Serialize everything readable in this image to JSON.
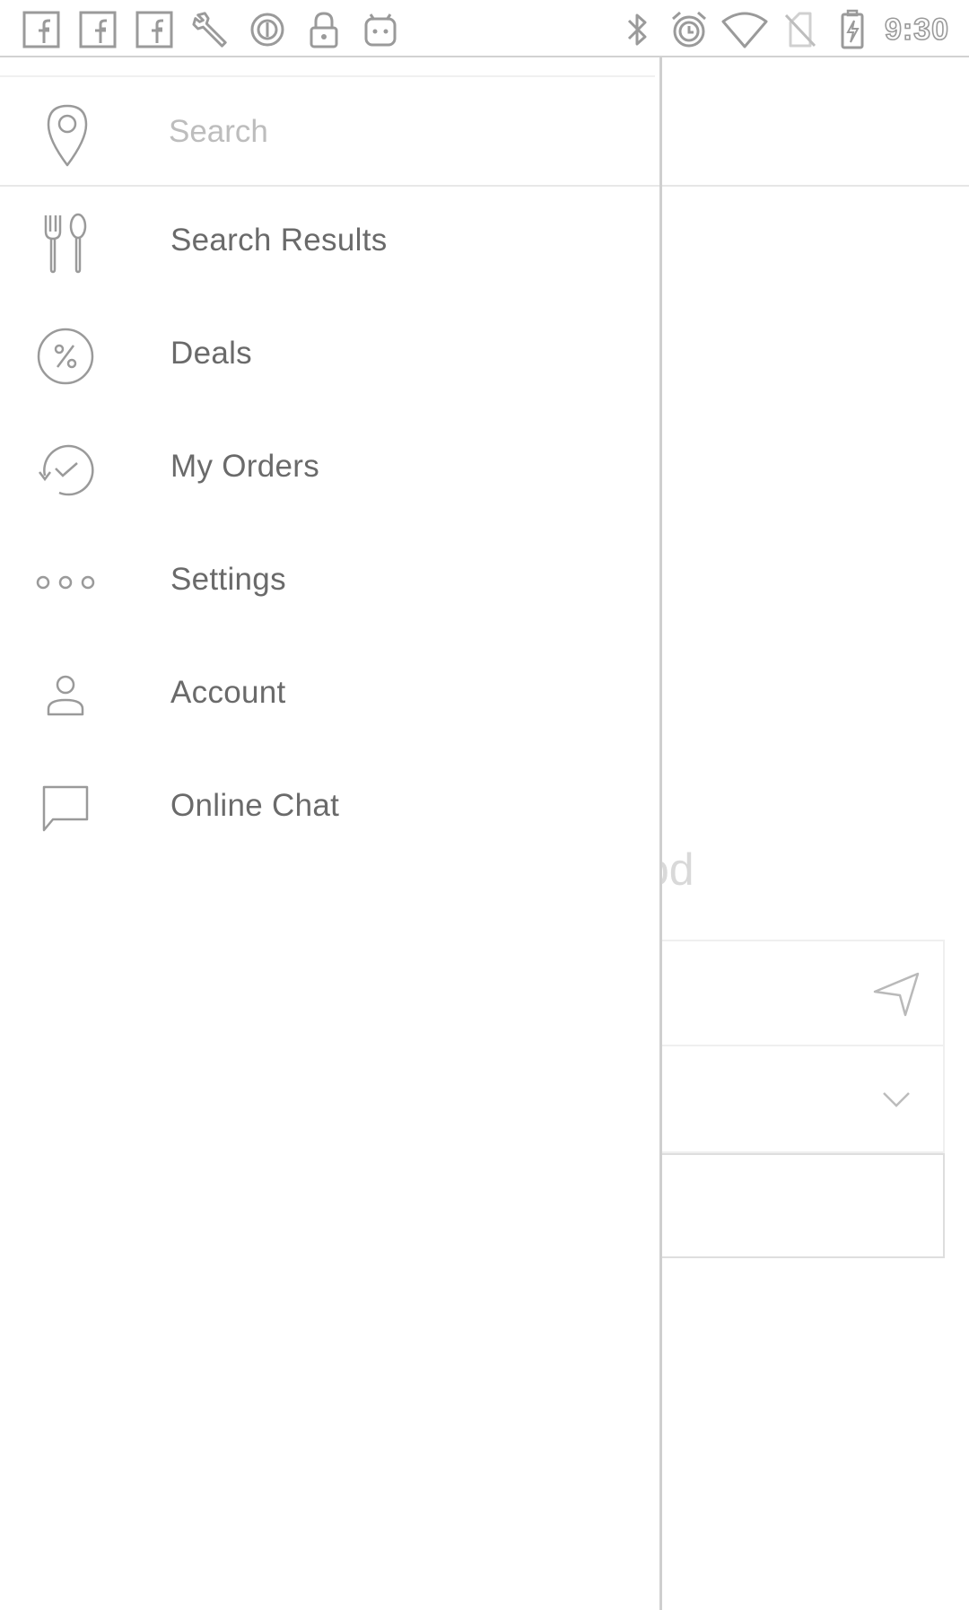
{
  "status_bar": {
    "left_icons": [
      "facebook-icon",
      "facebook-icon",
      "facebook-icon",
      "wrench-icon",
      "sync-icon",
      "lock-icon",
      "android-icon"
    ],
    "right_icons": [
      "bluetooth-icon",
      "alarm-icon",
      "wifi-icon",
      "no-sim-icon",
      "battery-charging-icon"
    ],
    "time": "9:30"
  },
  "drawer": {
    "search": {
      "placeholder": "Search",
      "value": "",
      "icon": "location-pin-icon"
    },
    "items": [
      {
        "label": "Search Results",
        "icon": "fork-spoon-icon"
      },
      {
        "label": "Deals",
        "icon": "percent-icon"
      },
      {
        "label": "My Orders",
        "icon": "order-history-icon"
      },
      {
        "label": "Settings",
        "icon": "more-dots-icon"
      },
      {
        "label": "Account",
        "icon": "person-icon"
      },
      {
        "label": "Online Chat",
        "icon": "chat-icon"
      }
    ]
  },
  "background": {
    "partial_text": "od",
    "location_icon": "navigation-arrow-icon",
    "dropdown_icon": "chevron-down-icon"
  },
  "colors": {
    "icon_gray": "#9a9a9a",
    "label_gray": "#6a6a6a",
    "placeholder_gray": "#bdbdbd",
    "divider": "#cfcfcf"
  }
}
